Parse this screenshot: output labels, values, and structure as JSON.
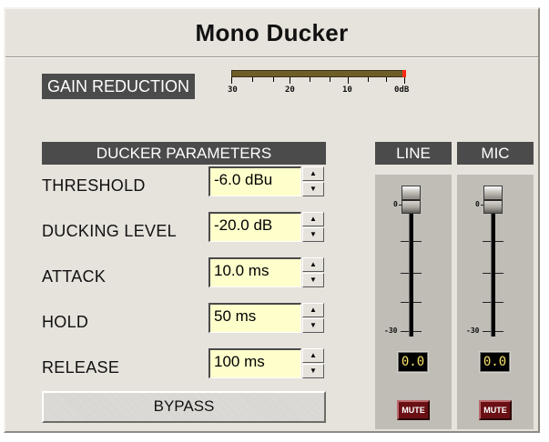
{
  "window": {
    "title": "Mono Ducker"
  },
  "gain_reduction": {
    "label": "GAIN REDUCTION",
    "scale_labels": [
      "30",
      "20",
      "10",
      "0dB"
    ],
    "level_db": 0
  },
  "ducker_parameters": {
    "header": "DUCKER PARAMETERS",
    "params": [
      {
        "label": "THRESHOLD",
        "value": "-6.0 dBu"
      },
      {
        "label": "DUCKING LEVEL",
        "value": "-20.0 dB"
      },
      {
        "label": "ATTACK",
        "value": "10.0 ms"
      },
      {
        "label": "HOLD",
        "value": "50 ms"
      },
      {
        "label": "RELEASE",
        "value": "100 ms"
      }
    ],
    "bypass_label": "BYPASS"
  },
  "channels": {
    "line": {
      "label": "LINE",
      "fader_top_label": "0",
      "fader_bottom_label": "-30",
      "level": "0.0",
      "mute_label": "MUTE"
    },
    "mic": {
      "label": "MIC",
      "fader_top_label": "0",
      "fader_bottom_label": "-30",
      "level": "0.0",
      "mute_label": "MUTE"
    }
  },
  "colors": {
    "panel": "#e6e2dc",
    "header_bg": "#4b4b4b",
    "input_bg": "#ffffcc",
    "meter": "#6e5d28",
    "meter_peak": "#ff2a10",
    "mute": "#6a0f14",
    "level_text": "#f6e26a"
  }
}
